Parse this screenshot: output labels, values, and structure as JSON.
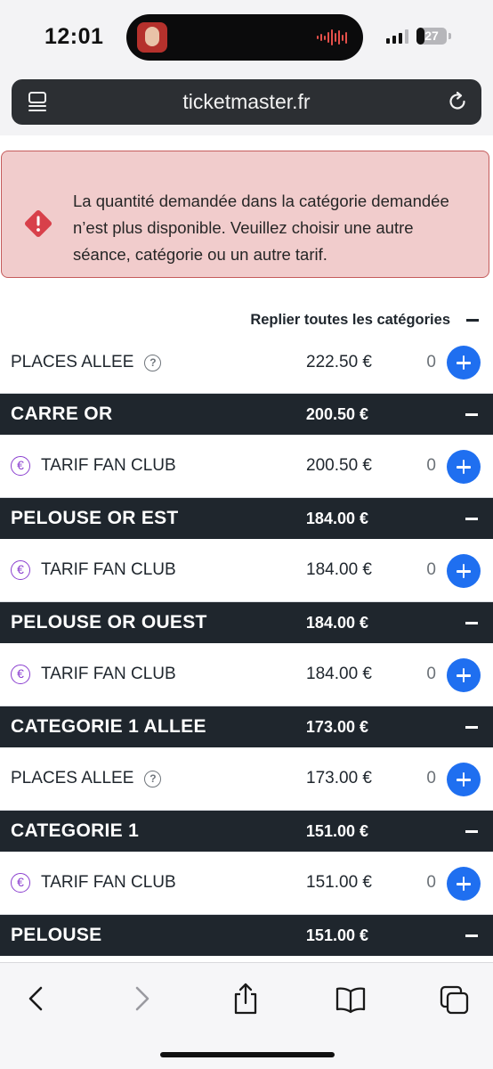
{
  "status_bar": {
    "time": "12:01",
    "battery": "27",
    "battery_level": 0.27
  },
  "browser": {
    "url": "ticketmaster.fr",
    "icons": [
      "reader-icon",
      "reload-icon"
    ],
    "toolbar_icons": [
      "back-icon",
      "forward-icon",
      "share-icon",
      "bookmarks-icon",
      "tabs-icon"
    ]
  },
  "alert": {
    "icon": "warning-diamond-icon",
    "message": "La quantité demandée dans la catégorie demandée n’est plus disponible. Veuillez choisir une autre séance, catégorie ou un autre tarif."
  },
  "collapse_all": {
    "label": "Replier toutes les catégories"
  },
  "first_row": {
    "label": "PLACES ALLEE",
    "price": "222.50 €",
    "qty": "0"
  },
  "categories": [
    {
      "name": "CARRE OR",
      "price": "200.50 €",
      "row": {
        "label": "TARIF FAN CLUB",
        "price": "200.50 €",
        "qty": "0",
        "icon": "euro-icon"
      }
    },
    {
      "name": "PELOUSE OR EST",
      "price": "184.00 €",
      "row": {
        "label": "TARIF FAN CLUB",
        "price": "184.00 €",
        "qty": "0",
        "icon": "euro-icon"
      }
    },
    {
      "name": "PELOUSE OR OUEST",
      "price": "184.00 €",
      "row": {
        "label": "TARIF FAN CLUB",
        "price": "184.00 €",
        "qty": "0",
        "icon": "euro-icon"
      }
    },
    {
      "name": "CATEGORIE 1 ALLEE",
      "price": "173.00 €",
      "row": {
        "label": "PLACES ALLEE",
        "price": "173.00 €",
        "qty": "0",
        "icon": "help-icon"
      }
    },
    {
      "name": "CATEGORIE 1",
      "price": "151.00 €",
      "row": {
        "label": "TARIF FAN CLUB",
        "price": "151.00 €",
        "qty": "0",
        "icon": "euro-icon"
      }
    },
    {
      "name": "PELOUSE",
      "price": "151.00 €"
    }
  ],
  "colors": {
    "category_bar": "#1f262d",
    "accent_blue": "#1f6ff0",
    "alert_bg": "#f1cccc",
    "alert_border": "#c55c5c",
    "alert_icon": "#d8404a",
    "euro_purple": "#8a3ecf"
  }
}
